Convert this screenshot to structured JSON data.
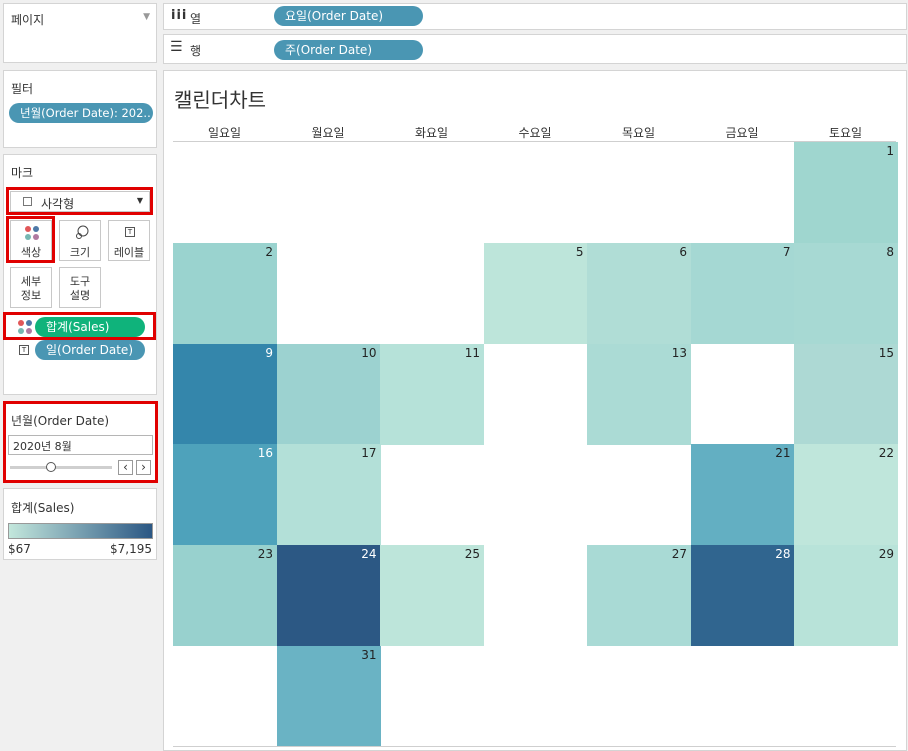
{
  "pages_panel": {
    "title": "페이지"
  },
  "columns_shelf": {
    "label": "열",
    "pill": "요일(Order Date)"
  },
  "rows_shelf": {
    "label": "행",
    "pill": "주(Order Date)"
  },
  "filters_panel": {
    "title": "필터",
    "pill": "년월(Order Date): 202.."
  },
  "marks_panel": {
    "title": "마크",
    "mark_type": "사각형",
    "buttons": {
      "color": "색상",
      "size": "크기",
      "label": "레이블",
      "detail": "세부\n정보",
      "tooltip": "도구\n설명"
    },
    "fields": [
      {
        "icon": "color-dots-icon",
        "pill": "합계(Sales)"
      },
      {
        "icon": "text-label-icon",
        "pill": "일(Order Date)"
      }
    ]
  },
  "date_filter": {
    "title": "년월(Order Date)",
    "value": "2020년 8월",
    "slider_position": 0.4
  },
  "legend": {
    "title": "합계(Sales)",
    "min_label": "$67",
    "max_label": "$7,195",
    "color_low": "#c3e7dc",
    "color_high": "#2b5784"
  },
  "chart_data": {
    "type": "heatmap",
    "title": "캘린더차트",
    "weekdays": [
      "일요일",
      "월요일",
      "화요일",
      "수요일",
      "목요일",
      "금요일",
      "토요일"
    ],
    "cells": [
      {
        "day": 1,
        "week": 0,
        "weekday": 6,
        "color": "#9fd6cf"
      },
      {
        "day": 2,
        "week": 1,
        "weekday": 0,
        "color": "#9ad3cf"
      },
      {
        "day": 5,
        "week": 1,
        "weekday": 3,
        "color": "#bde5da"
      },
      {
        "day": 6,
        "week": 1,
        "weekday": 4,
        "color": "#b0ddd6"
      },
      {
        "day": 7,
        "week": 1,
        "weekday": 5,
        "color": "#a5d8d3"
      },
      {
        "day": 8,
        "week": 1,
        "weekday": 6,
        "color": "#a7d9d3"
      },
      {
        "day": 9,
        "week": 2,
        "weekday": 0,
        "color": "#3486ab"
      },
      {
        "day": 10,
        "week": 2,
        "weekday": 1,
        "color": "#9cd2d0"
      },
      {
        "day": 11,
        "week": 2,
        "weekday": 2,
        "color": "#b6e2d9"
      },
      {
        "day": 13,
        "week": 2,
        "weekday": 4,
        "color": "#abdbd5"
      },
      {
        "day": 15,
        "week": 2,
        "weekday": 6,
        "color": "#add9d4"
      },
      {
        "day": 16,
        "week": 3,
        "weekday": 0,
        "color": "#4ea2bb"
      },
      {
        "day": 17,
        "week": 3,
        "weekday": 1,
        "color": "#b3e0d8"
      },
      {
        "day": 21,
        "week": 3,
        "weekday": 5,
        "color": "#63afc2"
      },
      {
        "day": 22,
        "week": 3,
        "weekday": 6,
        "color": "#bfe6db"
      },
      {
        "day": 23,
        "week": 4,
        "weekday": 0,
        "color": "#98d1ce"
      },
      {
        "day": 24,
        "week": 4,
        "weekday": 1,
        "color": "#2c5884"
      },
      {
        "day": 25,
        "week": 4,
        "weekday": 2,
        "color": "#bde5da"
      },
      {
        "day": 27,
        "week": 4,
        "weekday": 4,
        "color": "#a9dad5"
      },
      {
        "day": 28,
        "week": 4,
        "weekday": 5,
        "color": "#30658f"
      },
      {
        "day": 29,
        "week": 4,
        "weekday": 6,
        "color": "#b8e3d9"
      },
      {
        "day": 31,
        "week": 5,
        "weekday": 1,
        "color": "#6ab3c4"
      }
    ]
  }
}
